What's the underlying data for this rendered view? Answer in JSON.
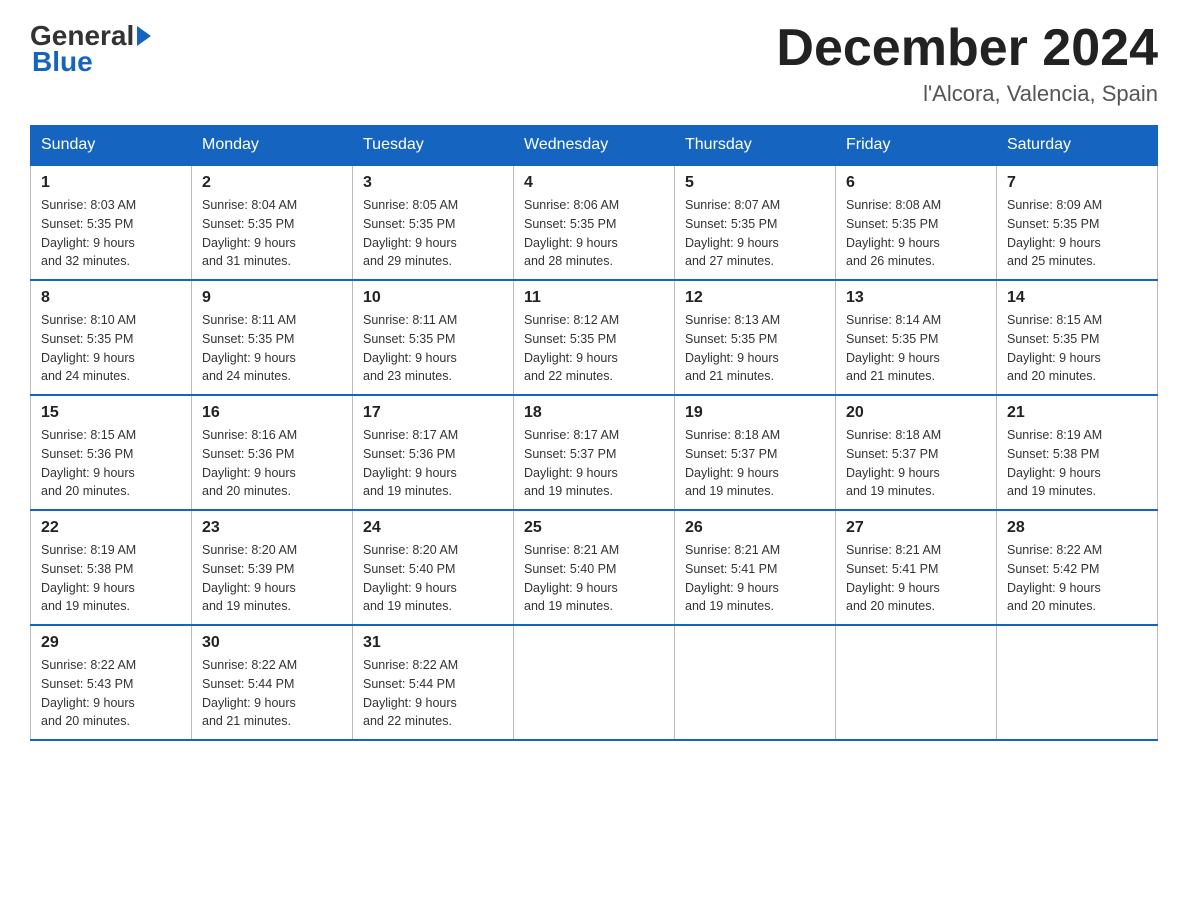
{
  "header": {
    "logo_text_general": "General",
    "logo_text_blue": "Blue",
    "month_title": "December 2024",
    "location": "l'Alcora, Valencia, Spain"
  },
  "weekdays": [
    "Sunday",
    "Monday",
    "Tuesday",
    "Wednesday",
    "Thursday",
    "Friday",
    "Saturday"
  ],
  "weeks": [
    [
      {
        "day": "1",
        "sunrise": "8:03 AM",
        "sunset": "5:35 PM",
        "daylight": "9 hours and 32 minutes."
      },
      {
        "day": "2",
        "sunrise": "8:04 AM",
        "sunset": "5:35 PM",
        "daylight": "9 hours and 31 minutes."
      },
      {
        "day": "3",
        "sunrise": "8:05 AM",
        "sunset": "5:35 PM",
        "daylight": "9 hours and 29 minutes."
      },
      {
        "day": "4",
        "sunrise": "8:06 AM",
        "sunset": "5:35 PM",
        "daylight": "9 hours and 28 minutes."
      },
      {
        "day": "5",
        "sunrise": "8:07 AM",
        "sunset": "5:35 PM",
        "daylight": "9 hours and 27 minutes."
      },
      {
        "day": "6",
        "sunrise": "8:08 AM",
        "sunset": "5:35 PM",
        "daylight": "9 hours and 26 minutes."
      },
      {
        "day": "7",
        "sunrise": "8:09 AM",
        "sunset": "5:35 PM",
        "daylight": "9 hours and 25 minutes."
      }
    ],
    [
      {
        "day": "8",
        "sunrise": "8:10 AM",
        "sunset": "5:35 PM",
        "daylight": "9 hours and 24 minutes."
      },
      {
        "day": "9",
        "sunrise": "8:11 AM",
        "sunset": "5:35 PM",
        "daylight": "9 hours and 24 minutes."
      },
      {
        "day": "10",
        "sunrise": "8:11 AM",
        "sunset": "5:35 PM",
        "daylight": "9 hours and 23 minutes."
      },
      {
        "day": "11",
        "sunrise": "8:12 AM",
        "sunset": "5:35 PM",
        "daylight": "9 hours and 22 minutes."
      },
      {
        "day": "12",
        "sunrise": "8:13 AM",
        "sunset": "5:35 PM",
        "daylight": "9 hours and 21 minutes."
      },
      {
        "day": "13",
        "sunrise": "8:14 AM",
        "sunset": "5:35 PM",
        "daylight": "9 hours and 21 minutes."
      },
      {
        "day": "14",
        "sunrise": "8:15 AM",
        "sunset": "5:35 PM",
        "daylight": "9 hours and 20 minutes."
      }
    ],
    [
      {
        "day": "15",
        "sunrise": "8:15 AM",
        "sunset": "5:36 PM",
        "daylight": "9 hours and 20 minutes."
      },
      {
        "day": "16",
        "sunrise": "8:16 AM",
        "sunset": "5:36 PM",
        "daylight": "9 hours and 20 minutes."
      },
      {
        "day": "17",
        "sunrise": "8:17 AM",
        "sunset": "5:36 PM",
        "daylight": "9 hours and 19 minutes."
      },
      {
        "day": "18",
        "sunrise": "8:17 AM",
        "sunset": "5:37 PM",
        "daylight": "9 hours and 19 minutes."
      },
      {
        "day": "19",
        "sunrise": "8:18 AM",
        "sunset": "5:37 PM",
        "daylight": "9 hours and 19 minutes."
      },
      {
        "day": "20",
        "sunrise": "8:18 AM",
        "sunset": "5:37 PM",
        "daylight": "9 hours and 19 minutes."
      },
      {
        "day": "21",
        "sunrise": "8:19 AM",
        "sunset": "5:38 PM",
        "daylight": "9 hours and 19 minutes."
      }
    ],
    [
      {
        "day": "22",
        "sunrise": "8:19 AM",
        "sunset": "5:38 PM",
        "daylight": "9 hours and 19 minutes."
      },
      {
        "day": "23",
        "sunrise": "8:20 AM",
        "sunset": "5:39 PM",
        "daylight": "9 hours and 19 minutes."
      },
      {
        "day": "24",
        "sunrise": "8:20 AM",
        "sunset": "5:40 PM",
        "daylight": "9 hours and 19 minutes."
      },
      {
        "day": "25",
        "sunrise": "8:21 AM",
        "sunset": "5:40 PM",
        "daylight": "9 hours and 19 minutes."
      },
      {
        "day": "26",
        "sunrise": "8:21 AM",
        "sunset": "5:41 PM",
        "daylight": "9 hours and 19 minutes."
      },
      {
        "day": "27",
        "sunrise": "8:21 AM",
        "sunset": "5:41 PM",
        "daylight": "9 hours and 20 minutes."
      },
      {
        "day": "28",
        "sunrise": "8:22 AM",
        "sunset": "5:42 PM",
        "daylight": "9 hours and 20 minutes."
      }
    ],
    [
      {
        "day": "29",
        "sunrise": "8:22 AM",
        "sunset": "5:43 PM",
        "daylight": "9 hours and 20 minutes."
      },
      {
        "day": "30",
        "sunrise": "8:22 AM",
        "sunset": "5:44 PM",
        "daylight": "9 hours and 21 minutes."
      },
      {
        "day": "31",
        "sunrise": "8:22 AM",
        "sunset": "5:44 PM",
        "daylight": "9 hours and 22 minutes."
      },
      null,
      null,
      null,
      null
    ]
  ],
  "labels": {
    "sunrise": "Sunrise:",
    "sunset": "Sunset:",
    "daylight": "Daylight:"
  }
}
